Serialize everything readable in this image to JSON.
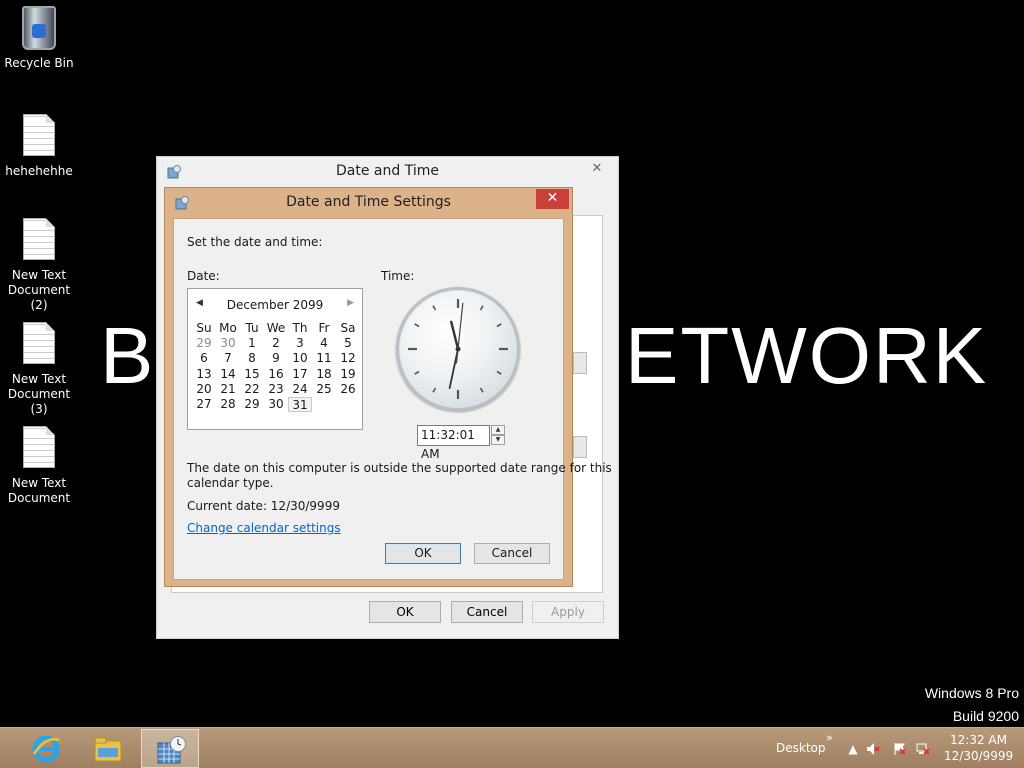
{
  "wallpaper": {
    "text_left": "B",
    "text_right": "ETWORK"
  },
  "desktop_icons": [
    {
      "label": "Recycle Bin",
      "icon": "recycle-bin-icon"
    },
    {
      "label": "hehehehhe",
      "icon": "text-document-icon"
    },
    {
      "label": "New Text Document (2)",
      "icon": "text-document-icon"
    },
    {
      "label": "New Text Document (3)",
      "icon": "text-document-icon"
    },
    {
      "label": "New Text Document",
      "icon": "text-document-icon"
    }
  ],
  "outer_dialog": {
    "title": "Date and Time",
    "close": "✕",
    "ok": "OK",
    "cancel": "Cancel",
    "apply": "Apply"
  },
  "settings_dialog": {
    "title": "Date and Time Settings",
    "close": "✕",
    "instruction": "Set the date and time:",
    "date_label": "Date:",
    "time_label": "Time:",
    "calendar": {
      "month_year": "December 2099",
      "weekdays": [
        "Su",
        "Mo",
        "Tu",
        "We",
        "Th",
        "Fr",
        "Sa"
      ],
      "weeks": [
        [
          "29",
          "30",
          "1",
          "2",
          "3",
          "4",
          "5"
        ],
        [
          "6",
          "7",
          "8",
          "9",
          "10",
          "11",
          "12"
        ],
        [
          "13",
          "14",
          "15",
          "16",
          "17",
          "18",
          "19"
        ],
        [
          "20",
          "21",
          "22",
          "23",
          "24",
          "25",
          "26"
        ],
        [
          "27",
          "28",
          "29",
          "30",
          "31",
          "",
          ""
        ]
      ],
      "selected_day": "31"
    },
    "clock": {
      "hour": 11,
      "minute": 32,
      "second": 1
    },
    "time_value": "11:32:01 AM",
    "warning_line1": "The date on this computer is outside the supported date range for this",
    "warning_line2": "calendar type.",
    "current_date": "Current date: 12/30/9999",
    "change_calendar_link": "Change calendar settings",
    "ok": "OK",
    "cancel": "Cancel"
  },
  "watermark": {
    "edition": "Windows 8 Pro",
    "build": "Build 9200"
  },
  "taskbar": {
    "apps": [
      {
        "name": "Internet Explorer",
        "icon": "internet-explorer-icon",
        "active": false
      },
      {
        "name": "File Explorer",
        "icon": "file-explorer-icon",
        "active": false
      },
      {
        "name": "Date and Time",
        "icon": "date-time-icon",
        "active": true
      }
    ],
    "desktop_toolbar": "Desktop",
    "chevron": "»",
    "tray_time": "12:32 AM",
    "tray_date": "12/30/9999"
  },
  "colors": {
    "taskbar": "#a88a6a",
    "dialog_frame": "#dcb28b",
    "close_button": "#c7403a",
    "link": "#0066cc"
  }
}
